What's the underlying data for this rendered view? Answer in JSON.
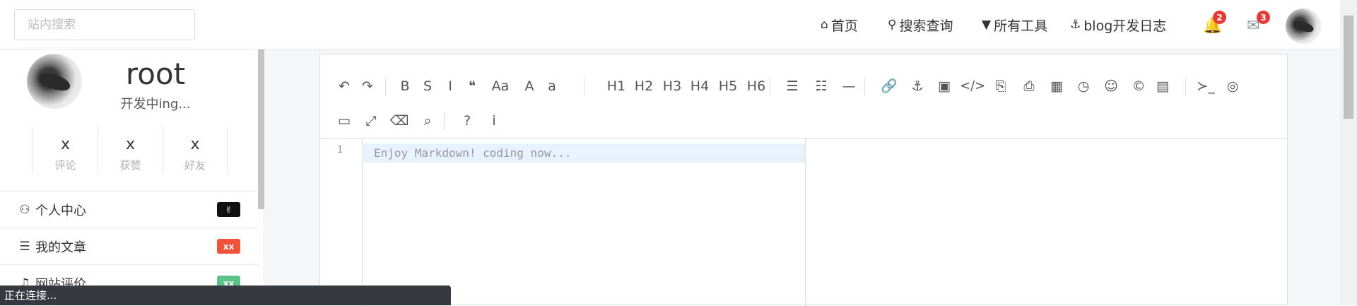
{
  "search": {
    "placeholder": "站内搜索"
  },
  "nav": [
    {
      "icon": "home-icon",
      "glyph": "⌂",
      "label": "首页"
    },
    {
      "icon": "search-icon",
      "glyph": "🔍",
      "label": "搜索查询"
    },
    {
      "icon": "filter-icon",
      "glyph": "▼",
      "label": "所有工具"
    },
    {
      "icon": "anchor-icon",
      "glyph": "⚓",
      "label": "blog开发日志"
    }
  ],
  "notifications": {
    "count": "2"
  },
  "messages": {
    "count": "3"
  },
  "profile": {
    "username": "root",
    "status": "开发中ing...",
    "stats": [
      {
        "value": "x",
        "label": "评论"
      },
      {
        "value": "x",
        "label": "获赞"
      },
      {
        "value": "x",
        "label": "好友"
      }
    ]
  },
  "menu": [
    {
      "label": "个人中心",
      "icon": "user-icon",
      "tag": "✌",
      "tag_color": "#111111"
    },
    {
      "label": "我的文章",
      "icon": "list-icon",
      "tag": "xx",
      "tag_color": "#f0533a"
    },
    {
      "label": "网站评价",
      "icon": "bell-icon",
      "tag": "xx",
      "tag_color": "#5cc28a"
    }
  ],
  "editor": {
    "line_number": "1",
    "placeholder": "Enjoy Markdown! coding now...",
    "toolbar_row1": [
      "↶",
      "↷",
      "B",
      "S",
      "I",
      "❝",
      "Aa",
      "A",
      "a",
      "H1",
      "H2",
      "H3",
      "H4",
      "H5",
      "H6",
      "☰",
      "☷",
      "—",
      "🔗",
      "⚓",
      "▣",
      "</>",
      "⎘",
      "⎙",
      "▦",
      "◷",
      "☺",
      "©",
      "▤",
      "≻_",
      "◎"
    ],
    "toolbar_row2": [
      "▭",
      "⤢",
      "⌫",
      "⌕",
      "?",
      "i"
    ]
  },
  "connection": {
    "status": "正在连接..."
  },
  "colors": {
    "badge": "#e53935",
    "connbar": "#343a40",
    "active_line": "#e8f2fe"
  }
}
